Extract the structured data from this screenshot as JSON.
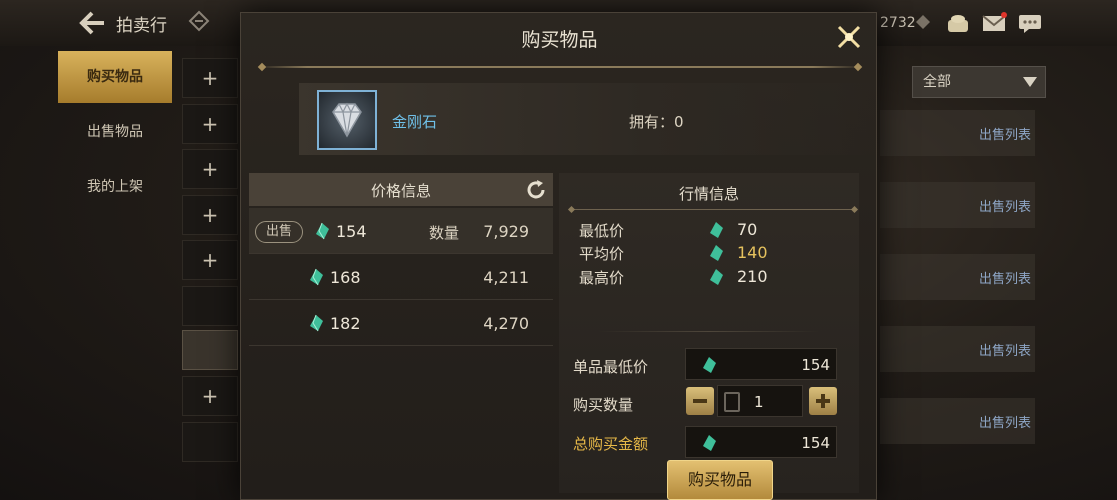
{
  "app": {
    "title": "拍卖行",
    "currency_count": "2732",
    "icons": [
      "back-arrow-icon",
      "gem-icon",
      "gift-box-icon",
      "mail-icon",
      "chat-icon"
    ]
  },
  "sidebar": {
    "items": [
      {
        "label": "购买物品",
        "active": true
      },
      {
        "label": "出售物品",
        "active": false
      },
      {
        "label": "我的上架",
        "active": false
      }
    ]
  },
  "filter": {
    "selected": "全部"
  },
  "sell_list": {
    "item_label": "出售列表",
    "rows": [
      "出售列表",
      "出售列表",
      "出售列表",
      "出售列表",
      "出售列表"
    ]
  },
  "modal": {
    "title": "购买物品",
    "item": {
      "name": "金刚石",
      "own_label": "拥有：0"
    },
    "price_info": {
      "header": "价格信息",
      "sell_badge": "出售",
      "qty_label": "数量",
      "rows": [
        {
          "price": "154",
          "qty": "7,929"
        },
        {
          "price": "168",
          "qty": "4,211"
        },
        {
          "price": "182",
          "qty": "4,270"
        }
      ]
    },
    "market_info": {
      "title": "行情信息",
      "min_label": "最低价",
      "min_value": "70",
      "avg_label": "平均价",
      "avg_value": "140",
      "max_label": "最高价",
      "max_value": "210"
    },
    "form": {
      "unit_min_label": "单品最低价",
      "unit_min_value": "154",
      "qty_label": "购买数量",
      "qty_value": "1",
      "total_label": "总购买金额",
      "total_value": "154"
    },
    "buy_button": "购买物品"
  },
  "colors": {
    "accent_gold": "#e6b848",
    "item_name_blue": "#6fc0e8",
    "gem_green": "#3fbf9a"
  }
}
